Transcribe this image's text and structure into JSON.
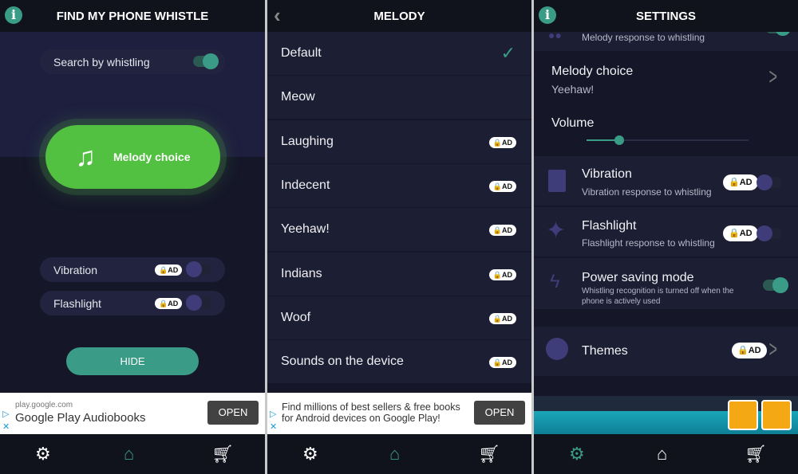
{
  "home": {
    "title": "FIND MY PHONE WHISTLE",
    "search_label": "Search by whistling",
    "search_on": true,
    "melody_button": "Melody choice",
    "vibration": "Vibration",
    "flashlight": "Flashlight",
    "ad_badge": "AD",
    "hide": "HIDE",
    "ad": {
      "domain": "play.google.com",
      "title": "Google Play Audiobooks",
      "open": "OPEN"
    }
  },
  "melody": {
    "title": "MELODY",
    "items": [
      {
        "label": "Default",
        "selected": true
      },
      {
        "label": "Meow"
      },
      {
        "label": "Laughing",
        "ad": "AD"
      },
      {
        "label": "Indecent",
        "ad": "AD"
      },
      {
        "label": "Yeehaw!",
        "ad": "AD"
      },
      {
        "label": "Indians",
        "ad": "AD"
      },
      {
        "label": "Woof",
        "ad": "AD"
      },
      {
        "label": "Sounds on the device",
        "ad": "AD"
      }
    ],
    "ad": {
      "line1": "Find millions of best sellers & free books",
      "line2": "for Android devices on Google Play!",
      "open": "OPEN"
    }
  },
  "settings": {
    "title": "SETTINGS",
    "melody_sub": "Melody response to whistling",
    "melody_choice": "Melody choice",
    "melody_value": "Yeehaw!",
    "volume": "Volume",
    "volume_level": 0.2,
    "vibration": {
      "title": "Vibration",
      "sub": "Vibration response to whistling",
      "ad": "AD",
      "on": false
    },
    "flashlight": {
      "title": "Flashlight",
      "sub": "Flashlight response to whistling",
      "ad": "AD",
      "on": false
    },
    "power": {
      "title": "Power saving mode",
      "sub1": "Whistling recognition is turned off when the",
      "sub2": "phone is actively used",
      "on": true
    },
    "themes": {
      "title": "Themes",
      "ad": "AD"
    }
  },
  "colors": {
    "accent": "#3a9c86",
    "green": "#52c041",
    "bg": "#151729"
  }
}
